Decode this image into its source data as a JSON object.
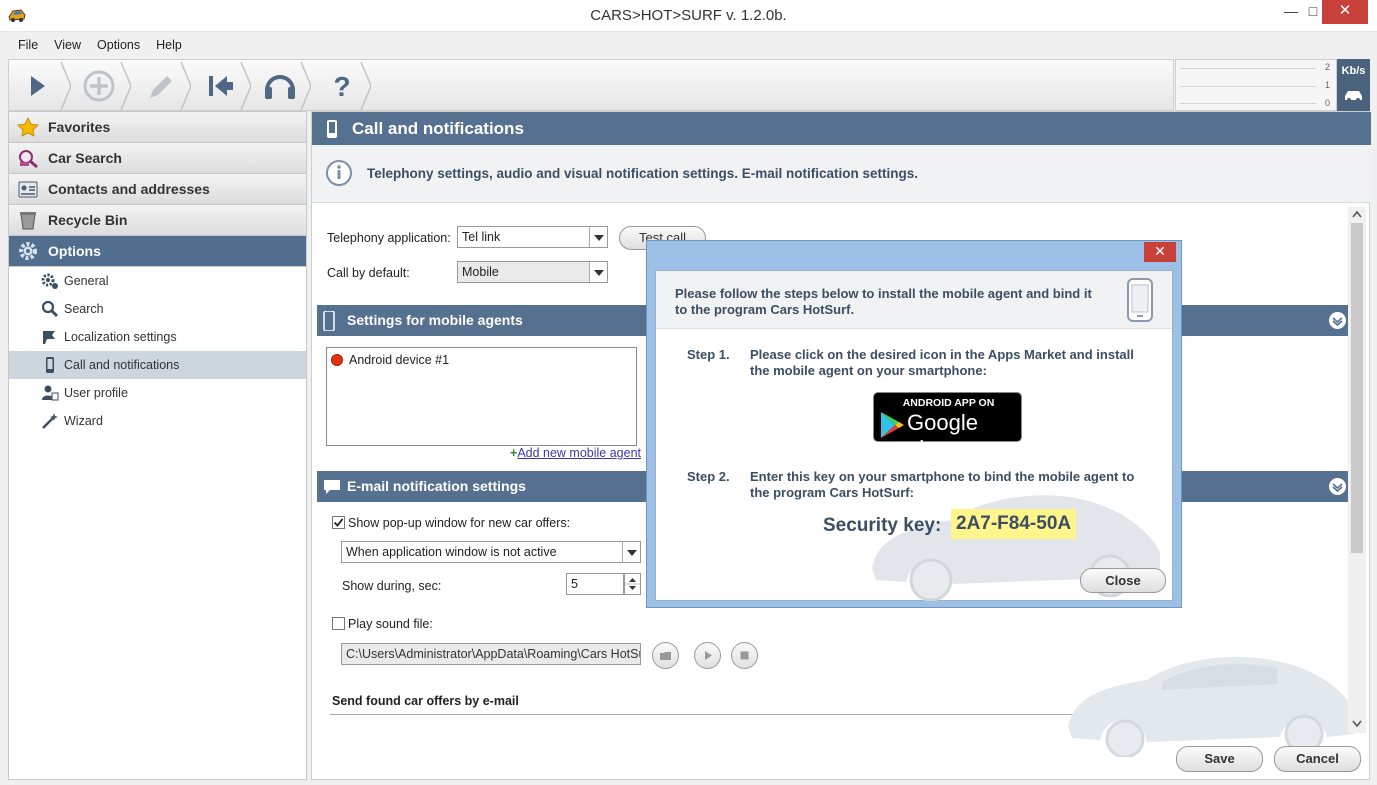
{
  "window": {
    "title": "CARS>HOT>SURF v. 1.2.0b.",
    "minimize": "—",
    "maximize": "□",
    "close": "✕"
  },
  "menu": [
    "File",
    "View",
    "Options",
    "Help"
  ],
  "toolbar": {
    "buttons": [
      "play-icon",
      "add-icon",
      "edit-icon",
      "go-first-icon",
      "headset-icon",
      "help-icon"
    ],
    "help_glyph": "?"
  },
  "speed": {
    "unit": "Kb/s",
    "ticks": [
      "2",
      "1",
      "0"
    ]
  },
  "sidebar": {
    "nav": [
      {
        "label": "Favorites",
        "icon": "star-icon"
      },
      {
        "label": "Car Search",
        "icon": "car-search-icon"
      },
      {
        "label": "Contacts and addresses",
        "icon": "contacts-icon"
      },
      {
        "label": "Recycle Bin",
        "icon": "recycle-bin-icon"
      },
      {
        "label": "Options",
        "icon": "gear-icon",
        "active": true
      }
    ],
    "sub": [
      {
        "label": "General",
        "icon": "gears-icon"
      },
      {
        "label": "Search",
        "icon": "magnifier-icon"
      },
      {
        "label": "Localization settings",
        "icon": "flag-icon"
      },
      {
        "label": "Call and notifications",
        "icon": "phone-icon",
        "active": true
      },
      {
        "label": "User profile",
        "icon": "user-profile-icon"
      },
      {
        "label": "Wizard",
        "icon": "wand-icon"
      }
    ]
  },
  "main": {
    "header": "Call and notifications",
    "info": "Telephony settings, audio and visual notification settings. E-mail notification settings.",
    "telephony_label": "Telephony application:",
    "telephony_value": "Tel link",
    "test_call": "Test call",
    "call_default_label": "Call by default:",
    "call_default_value": "Mobile",
    "mobile_section": "Settings for  mobile agents",
    "devices": [
      "Android device #1"
    ],
    "add_agent": "Add new mobile agent",
    "add_plus": "+",
    "email_section": "E-mail notification settings",
    "popup_check": "Show pop-up window for new car offers:",
    "popup_checked": true,
    "popup_mode": "When application window is not active",
    "show_during_label": "Show during, sec:",
    "show_during_value": "5",
    "play_sound": "Play sound file:",
    "play_sound_checked": false,
    "sound_path": "C:\\Users\\Administrator\\AppData\\Roaming\\Cars HotSurf",
    "send_email": "Send found car offers by e-mail",
    "save": "Save",
    "cancel": "Cancel"
  },
  "dialog": {
    "close_x": "✕",
    "header": "Please follow the steps below to install the mobile agent and bind it to the program Cars HotSurf.",
    "step1_no": "Step 1.",
    "step1_text": "Please click on the desired icon in the Apps Market and install the mobile agent on your smartphone:",
    "badge_top": "ANDROID APP ON",
    "badge_bottom": "Google play",
    "step2_no": "Step 2.",
    "step2_text": "Enter this key on your smartphone to bind the mobile agent to the program Cars HotSurf:",
    "security_label": "Security key:",
    "security_key": "2A7-F84-50A",
    "close": "Close"
  },
  "colors": {
    "accent": "#56708f",
    "key_highlight": "#fff58a",
    "close_red": "#c7413a",
    "dialog_frame": "#9cc0e6"
  }
}
